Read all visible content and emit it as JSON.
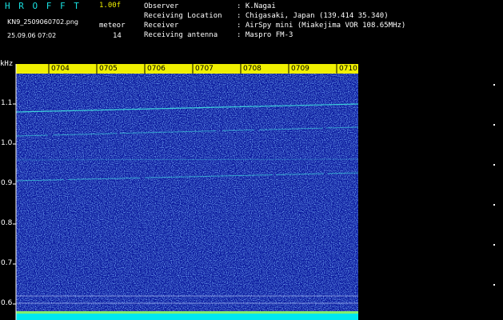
{
  "header": {
    "app_title": "H R O F F T",
    "version": "1.00f",
    "filename": "KN9_2509060702.png",
    "mode": "meteor",
    "datetime": "25.09.06 07:02",
    "count": "14"
  },
  "info": [
    {
      "label": "Observer",
      "value": ": K.Nagai"
    },
    {
      "label": "Receiving Location",
      "value": ": Chigasaki, Japan (139.414 35.340)"
    },
    {
      "label": "Receiver",
      "value": ": AirSpy mini (Miakejima VOR 108.65MHz)"
    },
    {
      "label": "Receiving antenna",
      "value": ": Maspro FM-3"
    }
  ],
  "colors": {
    "background": "#000000",
    "waterfall": "#0a1aa0",
    "signal": "#40e8e0",
    "title": "#18e0e0",
    "version": "#f0f000",
    "time_bar": "#f0f000",
    "bottom_band": "#00e8f0"
  },
  "axes": {
    "y_unit": "kHz",
    "y_ticks": [
      "1.1",
      "1.0",
      "0.9",
      "0.8",
      "0.7",
      "0.6"
    ],
    "x_ticks": [
      "0704",
      "0705",
      "0706",
      "0707",
      "0708",
      "0709",
      "0710"
    ]
  }
}
